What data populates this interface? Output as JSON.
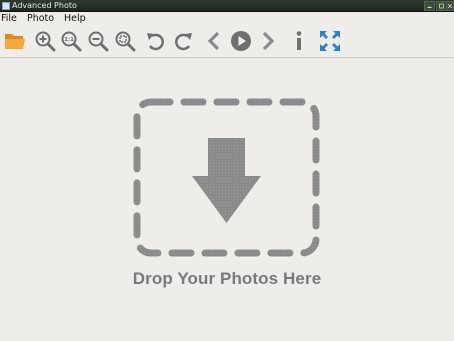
{
  "window": {
    "title": "Advanced Photo"
  },
  "menu": {
    "items": [
      {
        "label": "File"
      },
      {
        "label": "Photo"
      },
      {
        "label": "Help"
      }
    ]
  },
  "toolbar": {
    "buttons": [
      {
        "icon": "folder-open-icon"
      },
      {
        "icon": "zoom-in-icon"
      },
      {
        "icon": "zoom-actual-size-icon",
        "label": "1:1"
      },
      {
        "icon": "zoom-out-icon"
      },
      {
        "icon": "zoom-fit-icon"
      },
      {
        "icon": "rotate-left-icon"
      },
      {
        "icon": "rotate-right-icon"
      },
      {
        "icon": "previous-icon"
      },
      {
        "icon": "play-slideshow-icon"
      },
      {
        "icon": "next-icon"
      },
      {
        "icon": "info-icon"
      },
      {
        "icon": "fullscreen-icon"
      }
    ]
  },
  "dropzone": {
    "text": "Drop Your Photos Here"
  },
  "colors": {
    "background": "#efedea",
    "toolbar_icon": "#6f6f6f",
    "folder": "#f3a23a",
    "fullscreen": "#2f7fc8",
    "drop_graphic": "#8a8a8a"
  }
}
